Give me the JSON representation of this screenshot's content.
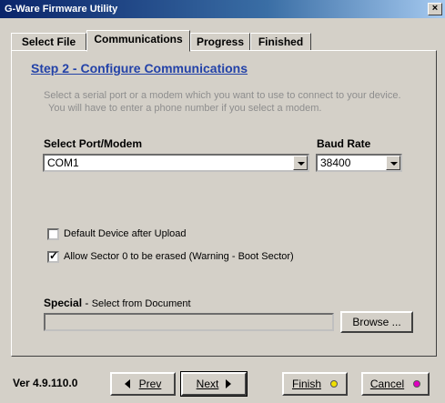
{
  "window": {
    "title": "G-Ware Firmware Utility",
    "close_glyph": "×"
  },
  "tabs": [
    {
      "label": "Select File",
      "active": false
    },
    {
      "label": "Communications",
      "active": true
    },
    {
      "label": "Progress",
      "active": false
    },
    {
      "label": "Finished",
      "active": false
    }
  ],
  "page": {
    "step_title": "Step 2 - Configure Communications",
    "description_line1": "Select a serial port or a modem which you want to use to connect to your device.",
    "description_line2": "You will have to enter a phone number if you select a modem."
  },
  "port": {
    "label": "Select Port/Modem",
    "value": "COM1"
  },
  "baud": {
    "label": "Baud Rate",
    "value": "38400"
  },
  "options": [
    {
      "label": "Default Device after Upload",
      "checked": false
    },
    {
      "label": "Allow Sector 0 to be erased (Warning - Boot Sector)",
      "checked": true
    }
  ],
  "special": {
    "label": "Special",
    "separator": " - ",
    "hint": "Select from Document",
    "value": "",
    "browse_label": "Browse ..."
  },
  "footer": {
    "version": "Ver 4.9.110.0",
    "prev_label": "Prev",
    "next_label": "Next",
    "finish_label": "Finish",
    "cancel_label": "Cancel",
    "finish_dot_color": "#f0e000",
    "cancel_dot_color": "#e000c0"
  },
  "icons": {
    "prev": "left-triangle-icon",
    "next": "right-triangle-icon",
    "finish": "yellow-dot-icon",
    "cancel": "magenta-dot-icon",
    "dropdown": "chevron-down-icon",
    "check": "checkmark-icon"
  }
}
